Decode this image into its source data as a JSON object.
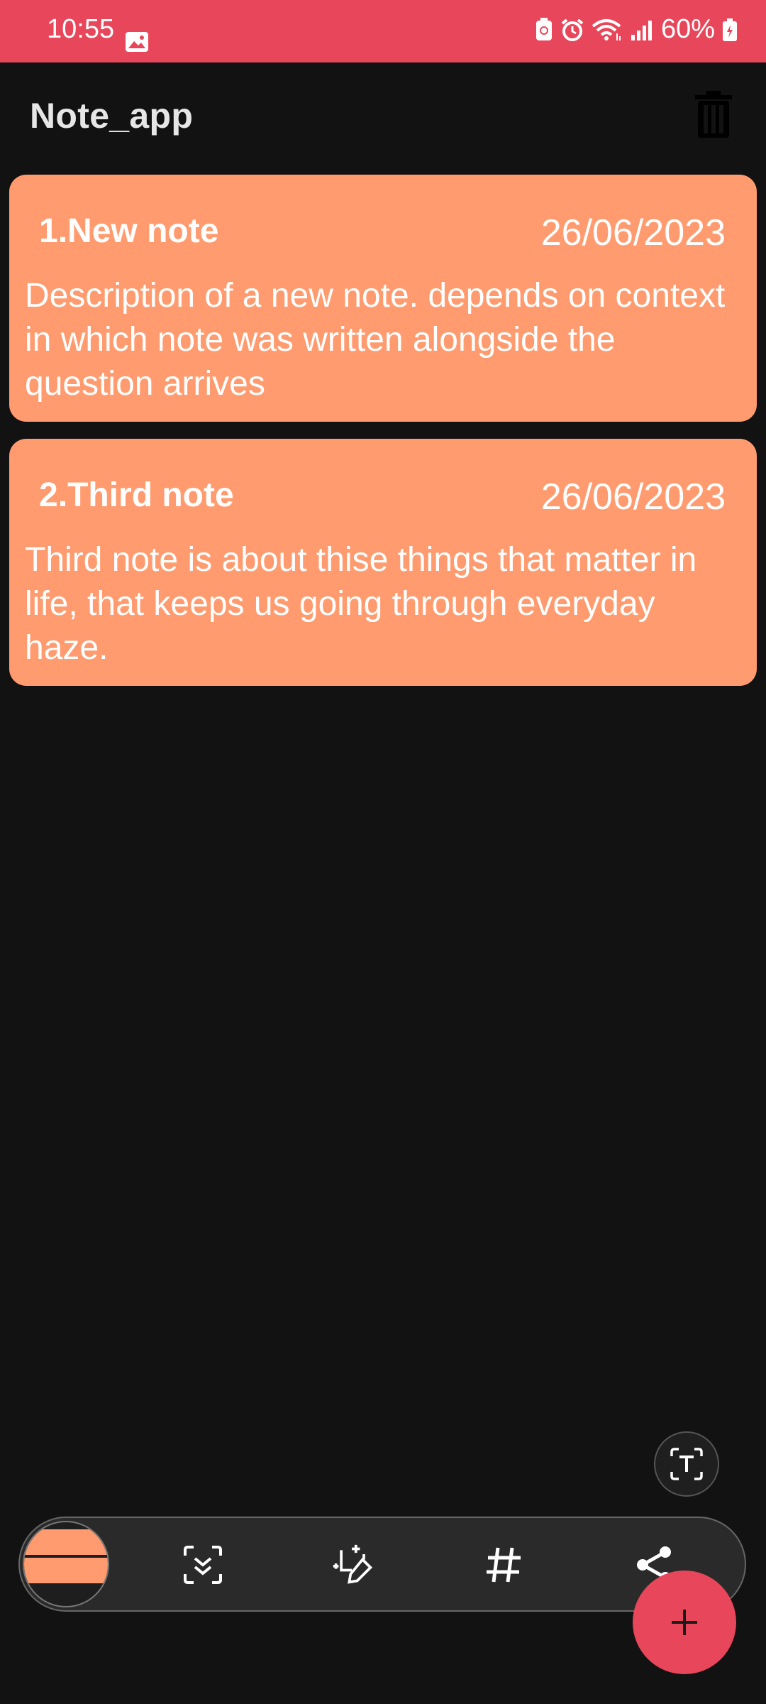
{
  "status_bar": {
    "time": "10:55",
    "battery": "60%"
  },
  "app_bar": {
    "title": "Note_app"
  },
  "notes": [
    {
      "title": "1.New note",
      "date": "26/06/2023",
      "description": "Description of a new note. depends on context in which note was written alongside the question arrives"
    },
    {
      "title": "2.Third note",
      "date": "26/06/2023",
      "description": "Third note is about thise things that matter in life, that keeps us going through everyday haze."
    }
  ],
  "colors": {
    "accent": "#e8465a",
    "card": "#ff9b6e",
    "background": "#121212"
  },
  "icons": {
    "delete": "trash-icon",
    "extract_text": "text-extract-icon",
    "scroll_capture": "scroll-capture-icon",
    "draw": "crop-draw-icon",
    "tags": "hashtag-icon",
    "share": "share-icon",
    "add": "plus-icon"
  }
}
